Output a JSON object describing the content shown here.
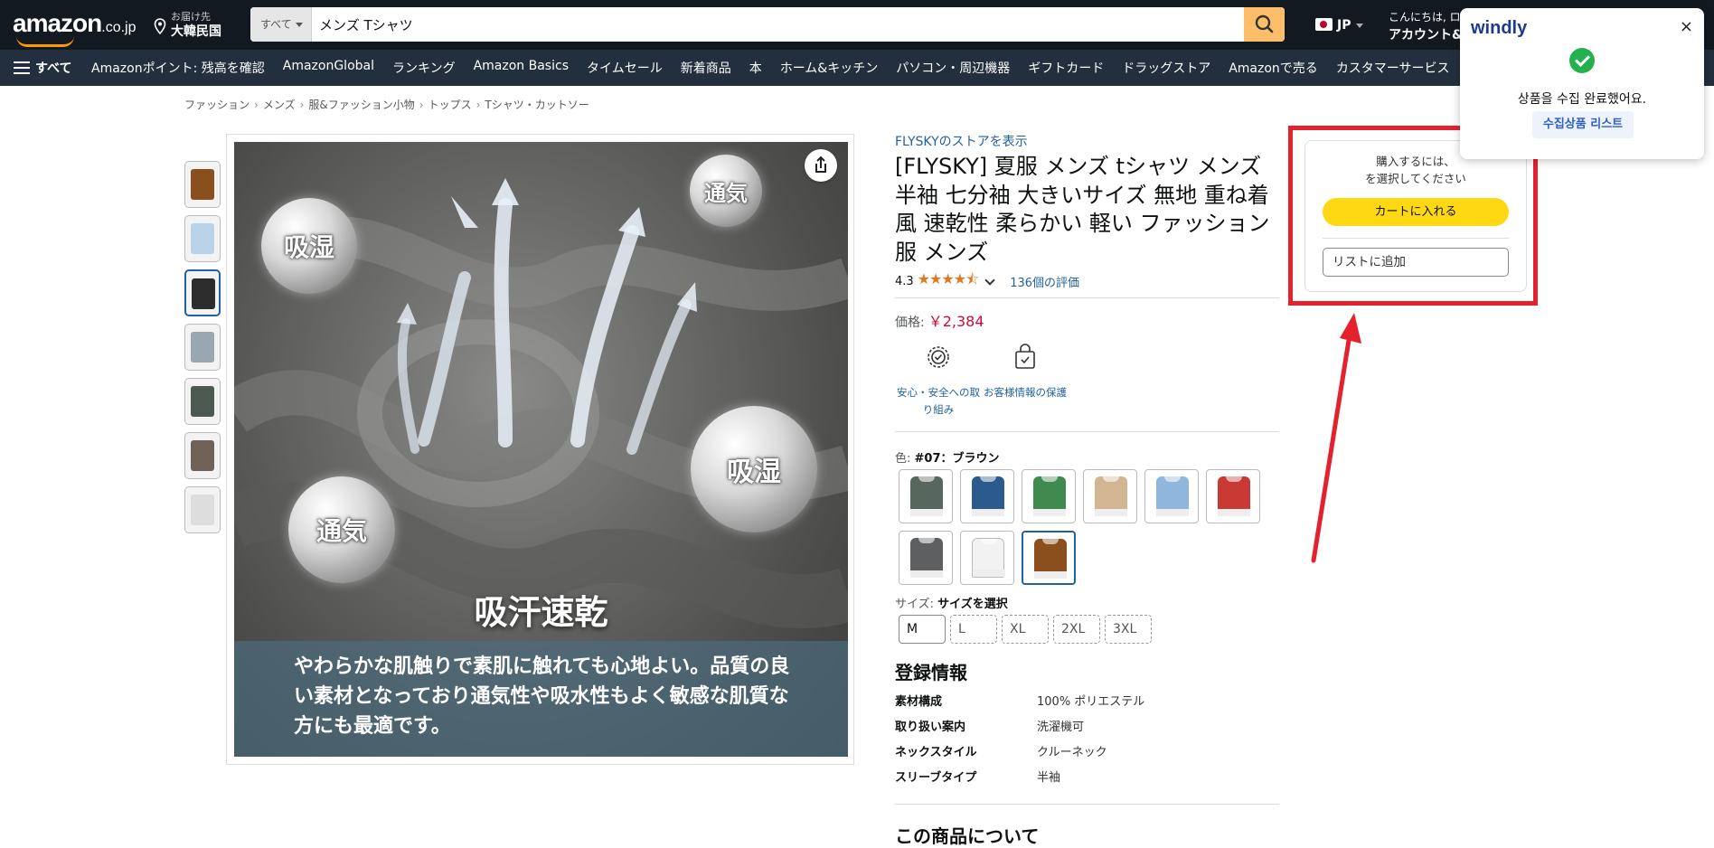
{
  "header": {
    "logo_text": "amazon",
    "logo_suffix": ".co.jp",
    "deliver_line1": "お届け先",
    "deliver_line2": "大韓民国",
    "search_category": "すべて",
    "search_value": "メンズ Tシャツ",
    "lang": "JP",
    "account_line1": "こんにちは, ロ",
    "account_line2": "アカウント&"
  },
  "nav": {
    "all_label": "すべて",
    "links": [
      "Amazonポイント: 残高を確認",
      "AmazonGlobal",
      "ランキング",
      "Amazon Basics",
      "タイムセール",
      "新着商品",
      "本",
      "ホーム&キッチン",
      "パソコン・周辺機器",
      "ギフトカード",
      "ドラッグストア",
      "Amazonで売る",
      "カスタマーサービス"
    ]
  },
  "breadcrumb": [
    "ファッション",
    "メンズ",
    "服&ファッション小物",
    "トップス",
    "Tシャツ・カットソー"
  ],
  "image": {
    "bubble_top_left": "吸湿",
    "bubble_top_right": "通気",
    "bubble_bottom_left": "通気",
    "bubble_right": "吸湿",
    "headline": "吸汗速乾",
    "band_text": "やわらかな肌触りで素肌に触れても心地よい。品質の良い素材となっており通気性や吸水性もよく敏感な肌質な方にも最適です。"
  },
  "product": {
    "store_link": "FLYSKYのストアを表示",
    "title": "[FLYSKY] 夏服 メンズ tシャツ メンズ 半袖 七分袖 大きいサイズ 無地 重ね着風 速乾性 柔らかい 軽い ファッション服 メンズ",
    "rating": "4.3",
    "stars": "★★★★⯪",
    "reviews": "136個の評価",
    "price_label": "価格:",
    "price": "￥2,384",
    "badge1": "安心・安全への取り組み",
    "badge2": "お客様情報の保護",
    "color_label": "色:",
    "color_value": "#07：ブラウン",
    "size_label": "サイズ:",
    "size_value": "サイズを選択",
    "sizes": [
      "M",
      "L",
      "XL",
      "2XL",
      "3XL"
    ],
    "reg_heading": "登録情報",
    "specs": [
      {
        "k": "素材構成",
        "v": "100% ポリエステル"
      },
      {
        "k": "取り扱い案内",
        "v": "洗濯機可"
      },
      {
        "k": "ネックスタイル",
        "v": "クルーネック"
      },
      {
        "k": "スリーブタイプ",
        "v": "半袖"
      }
    ],
    "about_heading": "この商品について"
  },
  "swatch_colors": [
    "#56675d",
    "#2a5a8e",
    "#3f8a4e",
    "#d2b591",
    "#8fb6dc",
    "#c83a33",
    "#5d5f60",
    "#f2f2f2",
    "#8b4f1d"
  ],
  "thumb_colors": [
    "#8b4f1d",
    "#b9d3e8",
    "#2d2d2d",
    "#9aa7b0",
    "#4c5a52",
    "#6f6258",
    "#dddddd"
  ],
  "buybox": {
    "message_line1": "購入するには、",
    "message_line2": "を選択してください",
    "cart_button": "カートに入れる",
    "list_button": "リストに追加"
  },
  "popup": {
    "brand": "windly",
    "close": "×",
    "message": "상품을 수집 완료했어요.",
    "list_link": "수집상품 리스트"
  },
  "accent_colors": {
    "highlight_red": "#e4222e",
    "cart_yellow": "#ffd814",
    "search_orange": "#febd69"
  }
}
